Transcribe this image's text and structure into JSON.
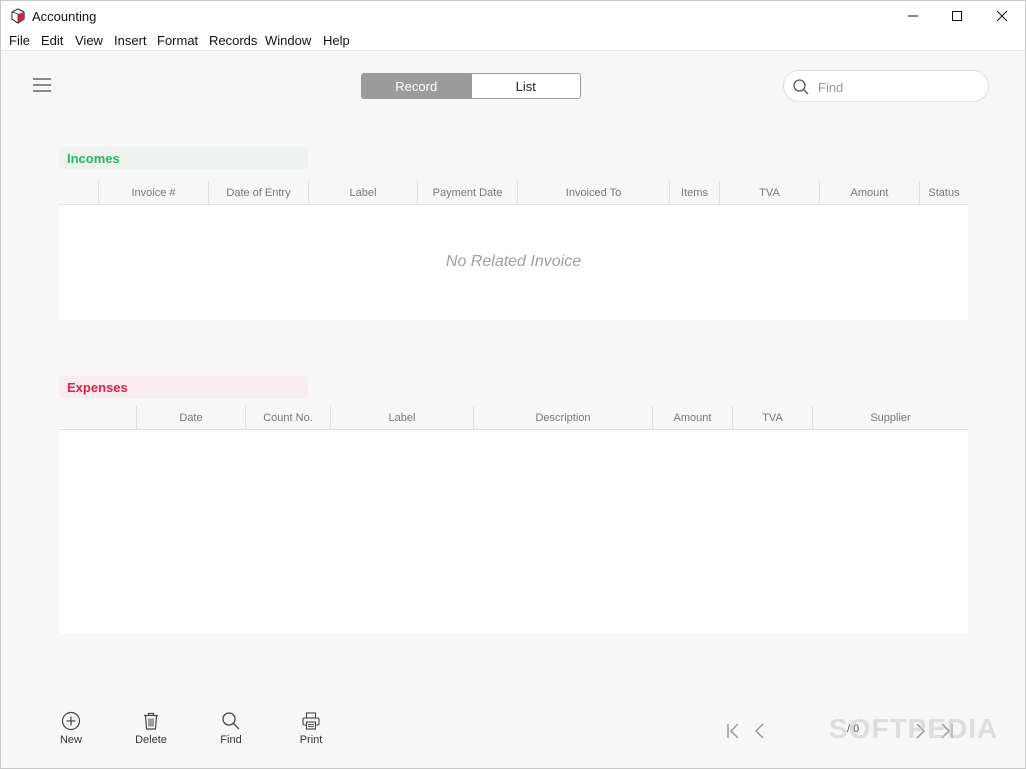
{
  "window": {
    "title": "Accounting"
  },
  "menu": [
    "File",
    "Edit",
    "View",
    "Insert",
    "Format",
    "Records",
    "Window",
    "Help"
  ],
  "view_toggle": {
    "record": "Record",
    "list": "List",
    "active": "Record"
  },
  "search": {
    "placeholder": "Find"
  },
  "incomes": {
    "label": "Incomes",
    "columns": [
      "Invoice #",
      "Date of Entry",
      "Label",
      "Payment Date",
      "Invoiced To",
      "Items",
      "TVA",
      "Amount",
      "Status"
    ],
    "empty_message": "No Related Invoice"
  },
  "expenses": {
    "label": "Expenses",
    "columns": [
      "Date",
      "Count No.",
      "Label",
      "Description",
      "Amount",
      "TVA",
      "Supplier"
    ]
  },
  "toolbar": {
    "new": "New",
    "delete": "Delete",
    "find": "Find",
    "print": "Print"
  },
  "pagination": {
    "text": "/ 0"
  },
  "watermark": "SOFTPEDIA",
  "colors": {
    "incomes": "#2bb36a",
    "expenses": "#e0224e",
    "toggle_active": "#9b9b9b"
  }
}
